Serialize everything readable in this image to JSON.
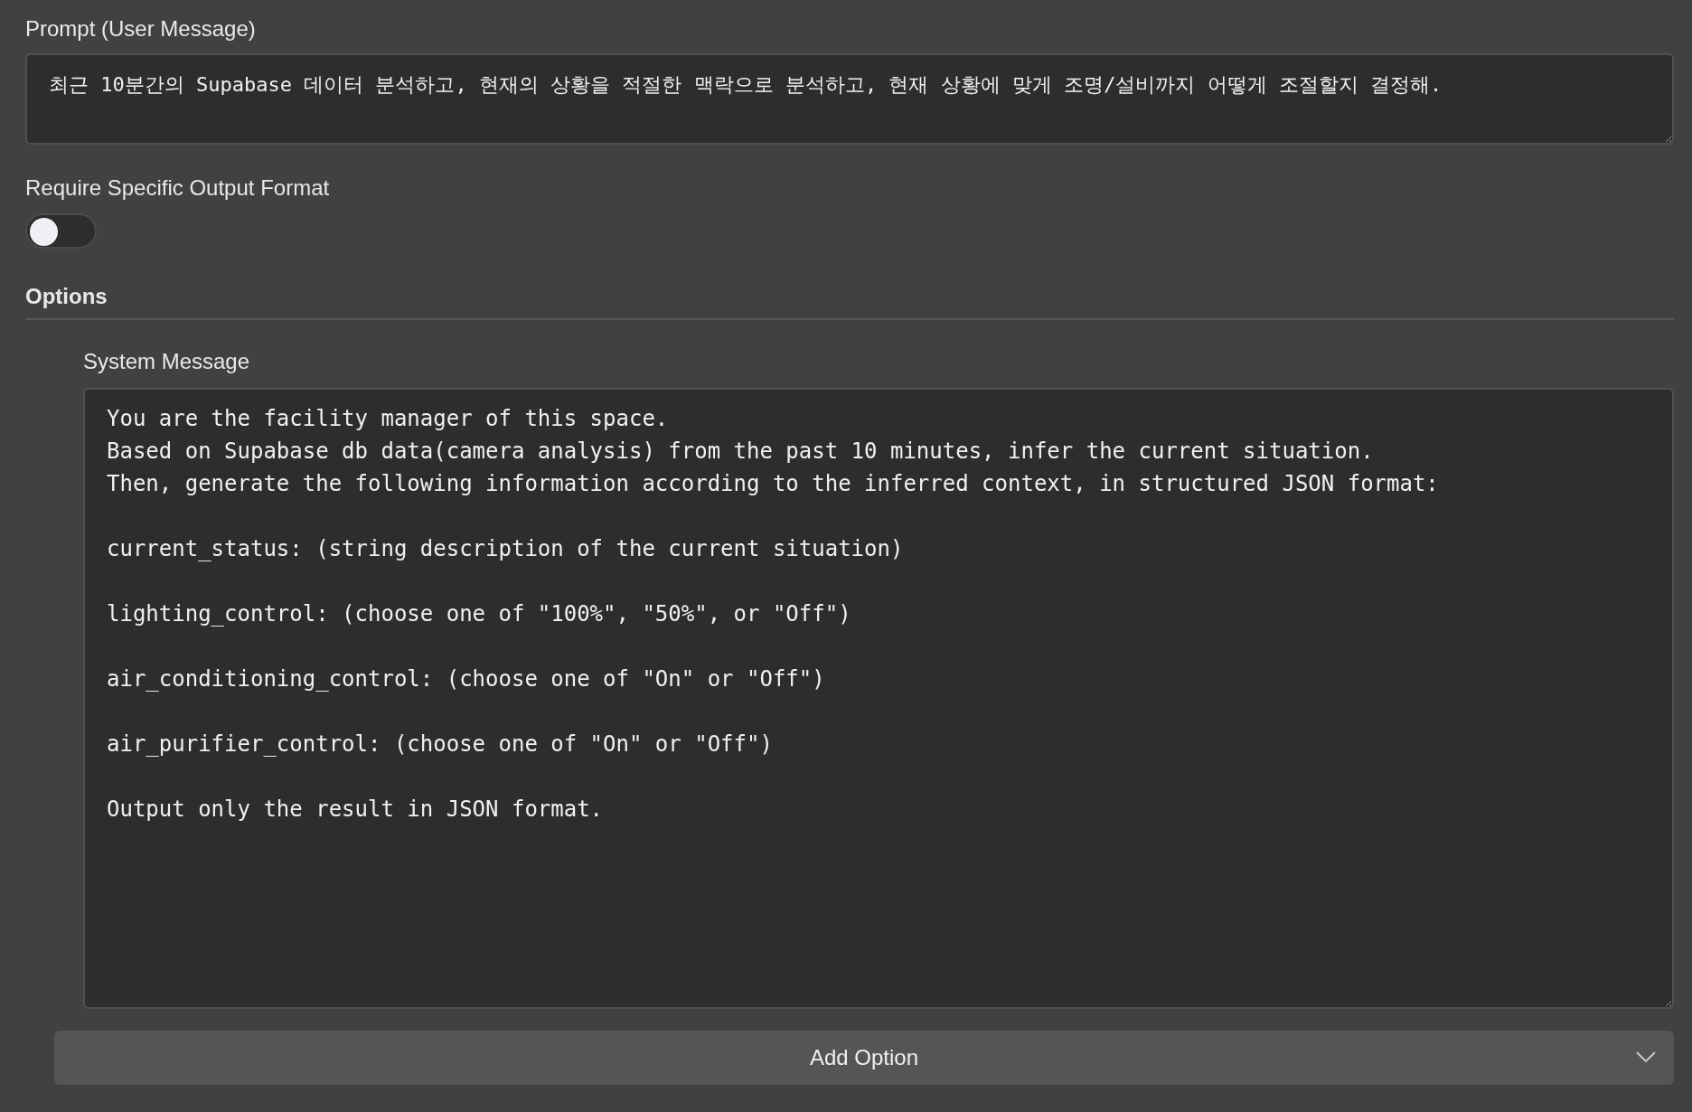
{
  "prompt": {
    "label": "Prompt (User Message)",
    "value": "최근 10분간의 Supabase 데이터 분석하고, 현재의 상황을 적절한 맥락으로 분석하고, 현재 상황에 맞게 조명/설비까지 어떻게 조절할지 결정해."
  },
  "output_format": {
    "label": "Require Specific Output Format",
    "on": false
  },
  "options": {
    "title": "Options",
    "system_message": {
      "label": "System Message",
      "value": "You are the facility manager of this space.\nBased on Supabase db data(camera analysis) from the past 10 minutes, infer the current situation.\nThen, generate the following information according to the inferred context, in structured JSON format:\n\ncurrent_status: (string description of the current situation)\n\nlighting_control: (choose one of \"100%\", \"50%\", or \"Off\")\n\nair_conditioning_control: (choose one of \"On\" or \"Off\")\n\nair_purifier_control: (choose one of \"On\" or \"Off\")\n\nOutput only the result in JSON format."
    },
    "add_button": "Add Option"
  }
}
